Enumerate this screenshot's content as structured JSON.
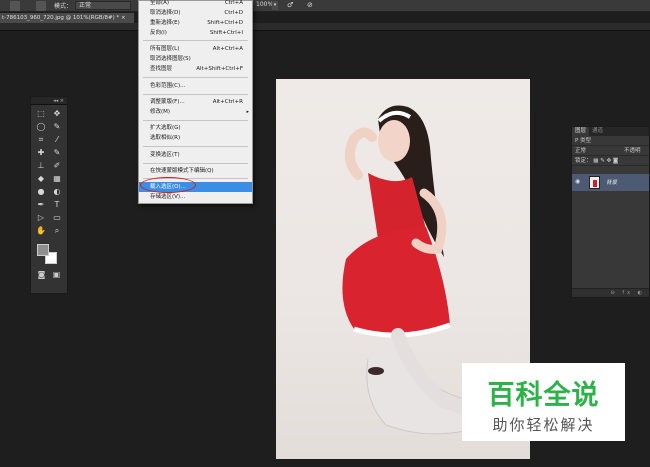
{
  "options_bar": {
    "mode_label": "模式：",
    "mode_value": "正常",
    "opacity_value": "100%",
    "opacity_arrow": "▾"
  },
  "document_tab": {
    "title": "t-786103_960_720.jpg @ 101%(RGB/8#) * ×"
  },
  "menu": {
    "items": [
      {
        "label": "全部(A)",
        "shortcut": "Ctrl+A"
      },
      {
        "label": "取消选择(D)",
        "shortcut": "Ctrl+D"
      },
      {
        "label": "重新选择(E)",
        "shortcut": "Shift+Ctrl+D"
      },
      {
        "label": "反向(I)",
        "shortcut": "Shift+Ctrl+I"
      },
      {
        "label": "所有图层(L)",
        "shortcut": "Alt+Ctrl+A"
      },
      {
        "label": "取消选择图层(S)",
        "shortcut": ""
      },
      {
        "label": "查找图层",
        "shortcut": "Alt+Shift+Ctrl+F"
      },
      {
        "label": "色彩范围(C)...",
        "shortcut": ""
      },
      {
        "label": "调整蒙版(F)...",
        "shortcut": "Alt+Ctrl+R"
      },
      {
        "label": "修改(M)",
        "shortcut": ""
      },
      {
        "label": "扩大选取(G)",
        "shortcut": ""
      },
      {
        "label": "选取相似(R)",
        "shortcut": ""
      },
      {
        "label": "变换选区(T)",
        "shortcut": ""
      },
      {
        "label": "在快速蒙版模式下编辑(Q)",
        "shortcut": ""
      },
      {
        "label": "载入选区(O)...",
        "shortcut": ""
      },
      {
        "label": "存储选区(V)...",
        "shortcut": ""
      }
    ],
    "submenu_arrow": "▸"
  },
  "layers_panel": {
    "tabs": [
      "图层",
      "通道"
    ],
    "filter_label": "P 类型",
    "blend_mode": "正常",
    "opacity_label": "不透明",
    "lock_label": "锁定：",
    "layer_name": "背景",
    "footer_icons": "⊖ fx ◐"
  },
  "watermark": {
    "title": "百科全说",
    "subtitle": "助你轻松解决",
    "title_color": "#2db24a"
  },
  "icons": [
    "move-icon",
    "marquee-icon",
    "lasso-icon",
    "quick-select-icon",
    "crop-icon",
    "eyedropper-icon",
    "healing-icon",
    "brush-icon",
    "stamp-icon",
    "history-brush-icon",
    "eraser-icon",
    "gradient-icon",
    "blur-icon",
    "dodge-icon",
    "pen-icon",
    "type-icon",
    "path-select-icon",
    "shape-icon",
    "hand-icon",
    "zoom-icon",
    "eye-icon"
  ]
}
